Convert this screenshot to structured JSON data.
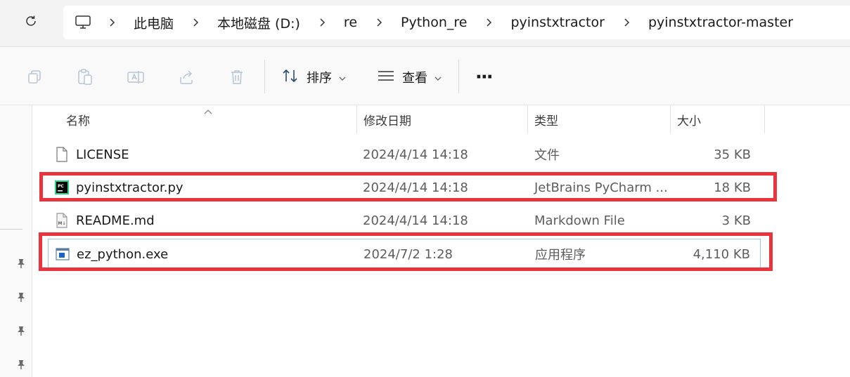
{
  "address_bar": {
    "breadcrumbs": [
      "此电脑",
      "本地磁盘 (D:)",
      "re",
      "Python_re",
      "pyinstxtractor",
      "pyinstxtractor-master"
    ],
    "icons": [
      "refresh-icon",
      "computer-icon",
      "chevron-right-icon"
    ]
  },
  "toolbar": {
    "sort_label": "排序",
    "view_label": "查看",
    "more_label": "···",
    "icons": [
      "copy-icon",
      "paste-icon",
      "rename-icon",
      "share-icon",
      "delete-icon",
      "sort-icon",
      "view-icon",
      "chevron-down-icon"
    ]
  },
  "columns": {
    "name": "名称",
    "modified": "修改日期",
    "type": "类型",
    "size": "大小"
  },
  "files": [
    {
      "name": "LICENSE",
      "modified": "2024/4/14 14:18",
      "type": "文件",
      "size": "35 KB",
      "icon": "blank-file-icon"
    },
    {
      "name": "pyinstxtractor.py",
      "modified": "2024/4/14 14:18",
      "type": "JetBrains PyCharm ...",
      "size": "18 KB",
      "icon": "pycharm-file-icon"
    },
    {
      "name": "README.md",
      "modified": "2024/4/14 14:18",
      "type": "Markdown File",
      "size": "3 KB",
      "icon": "markdown-file-icon"
    },
    {
      "name": "ez_python.exe",
      "modified": "2024/7/2 1:28",
      "type": "应用程序",
      "size": "4,110 KB",
      "icon": "exe-file-icon"
    }
  ],
  "colors": {
    "highlight": "#e8343a",
    "selection_border": "#99c5e8",
    "pycharm_green": "#21d789",
    "exe_blue": "#1b64c4"
  }
}
